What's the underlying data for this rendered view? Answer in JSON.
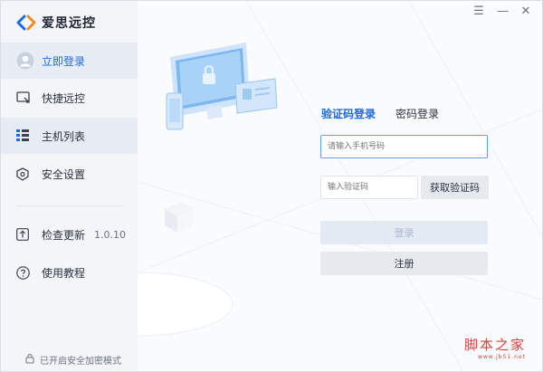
{
  "app": {
    "title": "爱思远控"
  },
  "window_controls": {
    "menu": "☰",
    "minimize": "—",
    "close": "✕"
  },
  "sidebar": {
    "items": [
      {
        "label": "立即登录",
        "icon": "avatar-icon"
      },
      {
        "label": "快捷远控",
        "icon": "remote-icon"
      },
      {
        "label": "主机列表",
        "icon": "host-list-icon"
      },
      {
        "label": "安全设置",
        "icon": "shield-icon"
      },
      {
        "label": "检查更新",
        "icon": "update-icon"
      },
      {
        "label": "使用教程",
        "icon": "help-icon"
      }
    ],
    "version": "1.0.10",
    "encryption_status": "已开启安全加密模式"
  },
  "login": {
    "tabs": [
      "验证码登录",
      "密码登录"
    ],
    "active_tab": 0,
    "phone_placeholder": "请输入手机号码",
    "phone_value": "",
    "code_placeholder": "输入验证码",
    "code_value": "",
    "get_code_label": "获取验证码",
    "login_label": "登录",
    "register_label": "注册"
  },
  "watermark": {
    "main": "脚本之家",
    "sub": "www.jb51.net"
  },
  "colors": {
    "accent": "#1c6ae0",
    "sidebar_bg": "#f3f5f9",
    "active_bg": "#e6ebf4"
  }
}
